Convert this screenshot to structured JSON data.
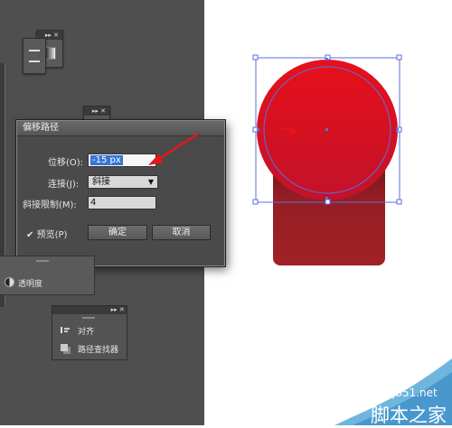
{
  "dialog": {
    "title": "偏移路径",
    "offset_label": "位移(O):",
    "offset_value": "-15 px",
    "join_label": "连接(J):",
    "join_value": "斜接",
    "miter_label": "斜接限制(M):",
    "miter_value": "4",
    "preview_label": "预览(P)",
    "preview_checked": true,
    "ok_label": "确定",
    "cancel_label": "取消"
  },
  "panels": {
    "transparency_label": "透明度",
    "align_label": "对齐",
    "pathfinder_label": "路径查找器",
    "collapse_glyph": "▸▸",
    "close_glyph": "✕"
  },
  "watermark": {
    "site": "jb51.net",
    "name": "脚本之家"
  },
  "colors": {
    "workspace": "#4f4f4f",
    "shape_red": "#d0101f",
    "shape_dark_red": "#8f1f24",
    "selection_blue": "#5a6fe0",
    "arrow_red": "#e8141a"
  }
}
